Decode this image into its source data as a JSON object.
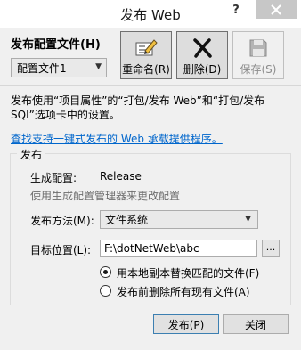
{
  "window": {
    "title": "发布 Web",
    "help_label": "?"
  },
  "profile": {
    "section_label": "发布配置文件(H)",
    "selected": "配置文件1"
  },
  "toolbar": {
    "rename_label": "重命名(R)",
    "delete_label": "删除(D)",
    "save_label": "保存(S)"
  },
  "description": {
    "text": "发布使用“项目属性”的“打包/发布 Web”和“打包/发布 SQL”选项卡中的设置。",
    "link": "查找支持一键式发布的 Web 承载提供程序。"
  },
  "publish_group": {
    "title": "发布",
    "build_config_label": "生成配置:",
    "build_config_value": "Release",
    "config_hint": "使用生成配置管理器来更改配置",
    "method_label": "发布方法(M):",
    "method_value": "文件系统",
    "target_label": "目标位置(L):",
    "target_value": "F:\\dotNetWeb\\abc",
    "browse_label": "...",
    "option_replace": "用本地副本替换匹配的文件(F)",
    "option_delete": "发布前删除所有现有文件(A)",
    "option_replace_checked": true,
    "option_delete_checked": false
  },
  "footer": {
    "publish_label": "发布(P)",
    "close_label": "关闭"
  },
  "icons": {
    "rename": "rename-edit-icon",
    "delete": "delete-x-icon",
    "save": "save-floppy-icon",
    "close": "close-icon"
  },
  "colors": {
    "close_button_bg": "#c7c7c7",
    "link": "#0066cc",
    "default_button_border": "#3c7fb1"
  }
}
